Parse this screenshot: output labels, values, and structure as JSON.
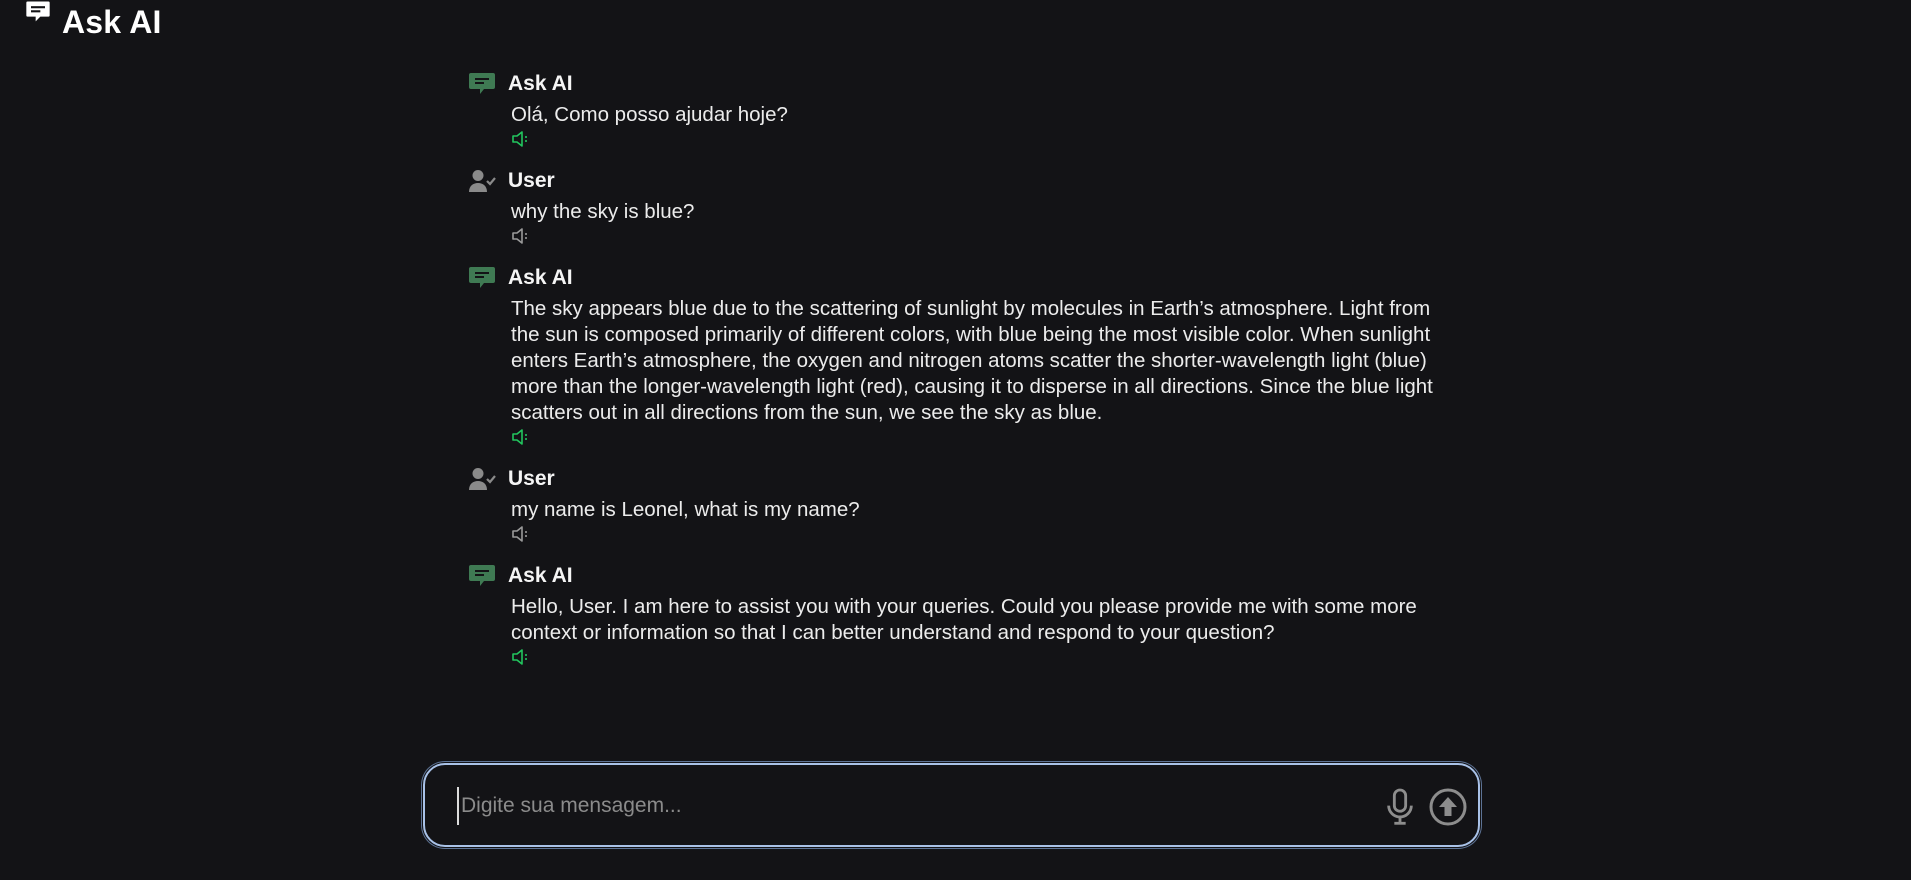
{
  "app": {
    "title": "Ask AI",
    "icon": "chat-bubble-icon"
  },
  "colors": {
    "background": "#131316",
    "ai_icon": "#3f7a53",
    "user_icon": "#8a8a8a",
    "speaker_ai": "#22c55e",
    "speaker_user": "#9a9a9a",
    "composer_border": "#a9c2e8"
  },
  "messages": [
    {
      "role": "ai",
      "name": "Ask AI",
      "icon": "chat-bubble-icon",
      "text": "Olá, Como posso ajudar hoje?",
      "speaker_icon": "speaker-icon"
    },
    {
      "role": "user",
      "name": "User",
      "icon": "user-check-icon",
      "text": "why the sky is blue?",
      "speaker_icon": "speaker-icon"
    },
    {
      "role": "ai",
      "name": "Ask AI",
      "icon": "chat-bubble-icon",
      "text": "The sky appears blue due to the scattering of sunlight by molecules in Earth’s atmosphere. Light from the sun is composed primarily of different colors, with blue being the most visible color. When sunlight enters Earth’s atmosphere, the oxygen and nitrogen atoms scatter the shorter-wavelength light (blue) more than the longer-wavelength light (red), causing it to disperse in all directions. Since the blue light scatters out in all directions from the sun, we see the sky as blue.",
      "speaker_icon": "speaker-icon"
    },
    {
      "role": "user",
      "name": "User",
      "icon": "user-check-icon",
      "text": "my name is Leonel, what is my name?",
      "speaker_icon": "speaker-icon"
    },
    {
      "role": "ai",
      "name": "Ask AI",
      "icon": "chat-bubble-icon",
      "text": "Hello, User. I am here to assist you with your queries. Could you please provide me with some more context or information so that I can better understand and respond to your question?",
      "speaker_icon": "speaker-icon"
    }
  ],
  "composer": {
    "placeholder": "Digite sua mensagem...",
    "value": "",
    "mic_icon": "microphone-icon",
    "send_icon": "arrow-up-circle-icon"
  }
}
